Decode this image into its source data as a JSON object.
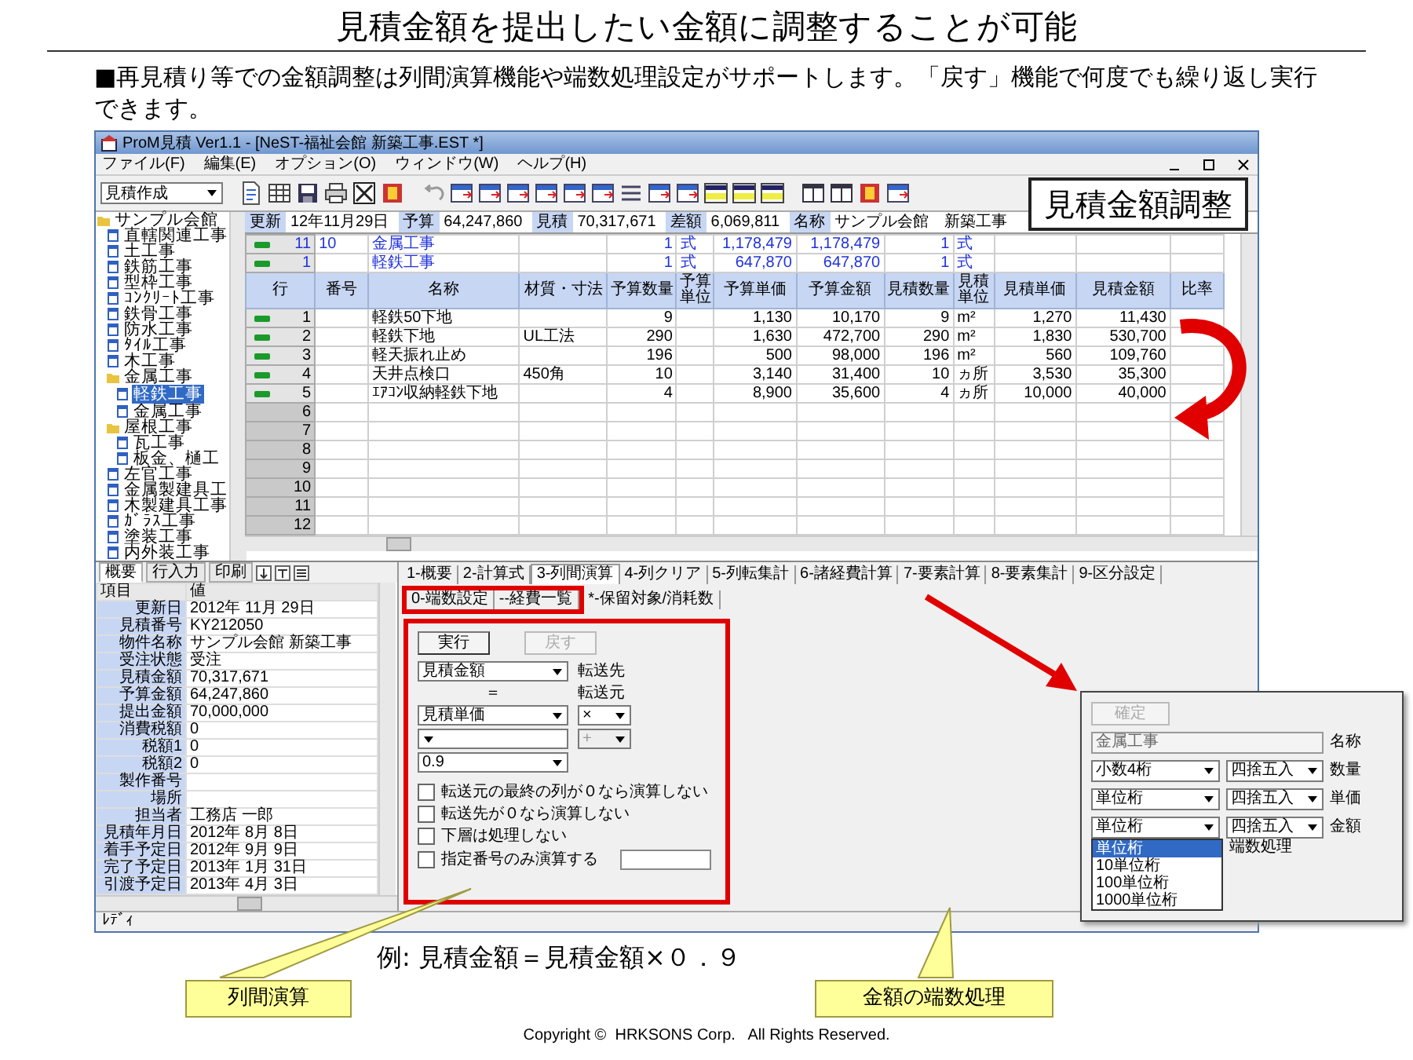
{
  "slide_title": "見積金額を提出したい金額に調整することが可能",
  "intro": "■再見積り等での金額調整は列間演算機能や端数処理設定がサポートします。「戻す」機能で何度でも繰り返し実行できます。",
  "window": {
    "title": "ProM見積 Ver1.1 - [NeST-福祉会館 新築工事.EST *]",
    "menu": [
      "ファイル(F)",
      "編集(E)",
      "オプション(O)",
      "ウィンドウ(W)",
      "ヘルプ(H)"
    ],
    "mode": "見積作成"
  },
  "tree": [
    {
      "label": "サンプル会館",
      "kind": "folder",
      "selected": false,
      "children": [
        {
          "label": "直轄関連工事",
          "kind": "sheet",
          "selected": false
        },
        {
          "label": "土工事",
          "kind": "sheet",
          "selected": false
        },
        {
          "label": "鉄筋工事",
          "kind": "sheet",
          "selected": false
        },
        {
          "label": "型枠工事",
          "kind": "sheet",
          "selected": false
        },
        {
          "label": "ｺﾝｸﾘｰﾄ工事",
          "kind": "sheet",
          "selected": false
        },
        {
          "label": "鉄骨工事",
          "kind": "sheet",
          "selected": false
        },
        {
          "label": "防水工事",
          "kind": "sheet",
          "selected": false
        },
        {
          "label": "ﾀｲﾙ工事",
          "kind": "sheet",
          "selected": false
        },
        {
          "label": "木工事",
          "kind": "sheet",
          "selected": false
        },
        {
          "label": "金属工事",
          "kind": "folder",
          "selected": false,
          "children": [
            {
              "label": "軽鉄工事",
              "kind": "sheet",
              "selected": true
            },
            {
              "label": "金属工事",
              "kind": "sheet",
              "selected": false
            }
          ]
        },
        {
          "label": "屋根工事",
          "kind": "folder",
          "selected": false,
          "children": [
            {
              "label": "瓦工事",
              "kind": "sheet",
              "selected": false
            },
            {
              "label": "板金、樋工",
              "kind": "sheet",
              "selected": false
            }
          ]
        },
        {
          "label": "左官工事",
          "kind": "sheet",
          "selected": false
        },
        {
          "label": "金属製建具工",
          "kind": "sheet",
          "selected": false
        },
        {
          "label": "木製建具工事",
          "kind": "sheet",
          "selected": false
        },
        {
          "label": "ｶﾞﾗｽ工事",
          "kind": "sheet",
          "selected": false
        },
        {
          "label": "塗装工事",
          "kind": "sheet",
          "selected": false
        },
        {
          "label": "内外装工事",
          "kind": "sheet",
          "selected": false
        }
      ]
    }
  ],
  "summary": [
    {
      "label": "更新",
      "value": "12年11月29日"
    },
    {
      "label": "予算",
      "value": "64,247,860"
    },
    {
      "label": "見積",
      "value": "70,317,671"
    },
    {
      "label": "差額",
      "value": "6,069,811"
    },
    {
      "label": "名称",
      "value": "サンプル会館　新築工事"
    }
  ],
  "grid": {
    "columns": [
      "行",
      "番号",
      "名称",
      "材質・寸法",
      "予算数量",
      "予算単位",
      "予算単価",
      "予算金額",
      "見積数量",
      "見積単位",
      "見積単価",
      "見積金額",
      "比率"
    ],
    "rows": [
      {
        "kind": "group",
        "row": "11",
        "no": "10",
        "name": "金属工事",
        "bq": "1",
        "bu": "式",
        "bp": "1,178,479",
        "ba": "1,178,479",
        "eq": "1",
        "eu": "式"
      },
      {
        "kind": "group",
        "row": "1",
        "name": "軽鉄工事",
        "bq": "1",
        "bu": "式",
        "bp": "647,870",
        "ba": "647,870",
        "eq": "1",
        "eu": "式"
      },
      {
        "kind": "header"
      },
      {
        "kind": "item",
        "row": "1",
        "name": "軽鉄50下地",
        "bq": "9",
        "bp": "1,130",
        "ba": "10,170",
        "eq": "9",
        "eu": "m²",
        "ep": "1,270",
        "ea": "11,430"
      },
      {
        "kind": "item",
        "row": "2",
        "name": "軽鉄下地",
        "spec": "UL工法",
        "bq": "290",
        "bp": "1,630",
        "ba": "472,700",
        "eq": "290",
        "eu": "m²",
        "ep": "1,830",
        "ea": "530,700"
      },
      {
        "kind": "item",
        "row": "3",
        "name": "軽天振れ止め",
        "bq": "196",
        "bp": "500",
        "ba": "98,000",
        "eq": "196",
        "eu": "m²",
        "ep": "560",
        "ea": "109,760"
      },
      {
        "kind": "item",
        "row": "4",
        "name": "天井点検口",
        "spec": "450角",
        "bq": "10",
        "bp": "3,140",
        "ba": "31,400",
        "eq": "10",
        "eu": "ヵ所",
        "ep": "3,530",
        "ea": "35,300"
      },
      {
        "kind": "item",
        "row": "5",
        "name": "ｴｱｺﾝ収納軽鉄下地",
        "bq": "4",
        "bp": "8,900",
        "ba": "35,600",
        "eq": "4",
        "eu": "ヵ所",
        "ep": "10,000",
        "ea": "40,000"
      },
      {
        "kind": "empty",
        "row": "6"
      },
      {
        "kind": "empty",
        "row": "7"
      },
      {
        "kind": "empty",
        "row": "8"
      },
      {
        "kind": "empty",
        "row": "9"
      },
      {
        "kind": "empty",
        "row": "10"
      },
      {
        "kind": "empty",
        "row": "11"
      },
      {
        "kind": "empty",
        "row": "12"
      }
    ]
  },
  "side_tabs": [
    {
      "label": "概要",
      "selected": true
    },
    {
      "label": "行入力",
      "selected": false
    },
    {
      "label": "印刷",
      "selected": false
    }
  ],
  "properties": {
    "columns": [
      "項目",
      "値"
    ],
    "rows": [
      {
        "label": "更新日",
        "value": "2012年 11月 29日"
      },
      {
        "label": "見積番号",
        "value": "KY212050"
      },
      {
        "label": "物件名称",
        "value": "サンプル会館 新築工事"
      },
      {
        "label": "受注状態",
        "value": "受注"
      },
      {
        "label": "見積金額",
        "value": "70,317,671"
      },
      {
        "label": "予算金額",
        "value": "64,247,860"
      },
      {
        "label": "提出金額",
        "value": "70,000,000"
      },
      {
        "label": "消費税額",
        "value": "0"
      },
      {
        "label": "税額1",
        "value": "0"
      },
      {
        "label": "税額2",
        "value": "0"
      },
      {
        "label": "製作番号"
      },
      {
        "label": "場所"
      },
      {
        "label": "担当者",
        "value": "工務店 一郎"
      },
      {
        "label": "見積年月日",
        "value": "2012年 8月 8日"
      },
      {
        "label": "着手予定日",
        "value": "2012年 9月 9日"
      },
      {
        "label": "完了予定日",
        "value": "2013年 1月 31日"
      },
      {
        "label": "引渡予定日",
        "value": "2013年 4月 3日"
      }
    ]
  },
  "tabs": [
    {
      "label": "1-概要",
      "selected": false,
      "highlighted": false
    },
    {
      "label": "2-計算式",
      "selected": false,
      "highlighted": false
    },
    {
      "label": "3-列間演算",
      "selected": true,
      "highlighted": false
    },
    {
      "label": "4-列クリア",
      "selected": false,
      "highlighted": false
    },
    {
      "label": "5-列転集計",
      "selected": false,
      "highlighted": false
    },
    {
      "label": "6-諸経費計算",
      "selected": false,
      "highlighted": false
    },
    {
      "label": "7-要素計算",
      "selected": false,
      "highlighted": false
    },
    {
      "label": "8-要素集計",
      "selected": false,
      "highlighted": false
    },
    {
      "label": "9-区分設定",
      "selected": false,
      "highlighted": false
    },
    {
      "label": "0-端数設定",
      "selected": false,
      "highlighted": true
    },
    {
      "label": "--経費一覧",
      "selected": false,
      "highlighted": true
    },
    {
      "label": "*-保留対象/消耗数",
      "selected": false,
      "highlighted": false
    }
  ],
  "column_ops": {
    "buttons": [
      {
        "label": "実行",
        "disabled": false
      },
      {
        "label": "戻す",
        "disabled": true
      }
    ],
    "target": {
      "value": "見積金額",
      "label": "転送先"
    },
    "equals": "＝",
    "source": {
      "value": "見積単価",
      "label": "転送元"
    },
    "operator": {
      "value": "×",
      "disabled": false
    },
    "operand": {
      "disabled": false
    },
    "operator2": {
      "value": "+",
      "disabled": true
    },
    "factor": {
      "value": "0.9"
    },
    "checkboxes": [
      {
        "label": "転送元の最終の列が０なら演算しない",
        "checked": false
      },
      {
        "label": "転送先が０なら演算しない",
        "checked": false
      },
      {
        "label": "下層は処理しない",
        "checked": false
      },
      {
        "label": "指定番号のみ演算する",
        "checked": false,
        "kind": "with_field"
      }
    ]
  },
  "status_bar": "ﾚﾃﾞｨ",
  "headline_callout": "見積金額調整",
  "rounding_dialog": {
    "confirm": {
      "label": "確定",
      "disabled": true
    },
    "name": {
      "value": "金属工事",
      "label": "名称"
    },
    "rows": [
      {
        "digits": "小数4桁",
        "method": "四捨五入",
        "label": "数量"
      },
      {
        "digits": "単位桁",
        "method": "四捨五入",
        "label": "単価"
      },
      {
        "digits": "単位桁",
        "method": "四捨五入",
        "label": "金額"
      }
    ],
    "options": [
      {
        "label": "単位桁",
        "selected": true
      },
      {
        "label": "10単位桁",
        "selected": false
      },
      {
        "label": "100単位桁",
        "selected": false
      },
      {
        "label": "1000単位桁",
        "selected": false
      }
    ],
    "options_label": "端数処理"
  },
  "example": "例: 見積金額＝見積金額×０．９",
  "callouts": [
    "列間演算",
    "金額の端数処理"
  ],
  "footer": "Copyright ©  HRKSONS Corp.   All Rights Reserved."
}
